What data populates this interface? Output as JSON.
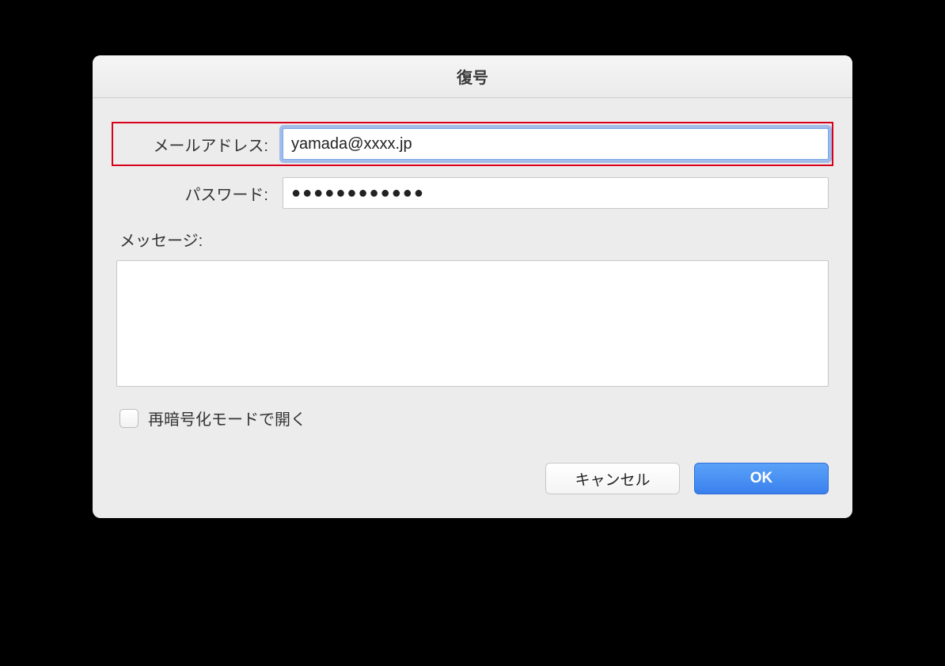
{
  "dialog": {
    "title": "復号",
    "email": {
      "label": "メールアドレス:",
      "value": "yamada@xxxx.jp"
    },
    "password": {
      "label": "パスワード:",
      "value": "●●●●●●●●●●●●"
    },
    "message": {
      "label": "メッセージ:",
      "value": ""
    },
    "checkbox": {
      "label": "再暗号化モードで開く",
      "checked": false
    },
    "buttons": {
      "cancel": "キャンセル",
      "ok": "OK"
    }
  }
}
